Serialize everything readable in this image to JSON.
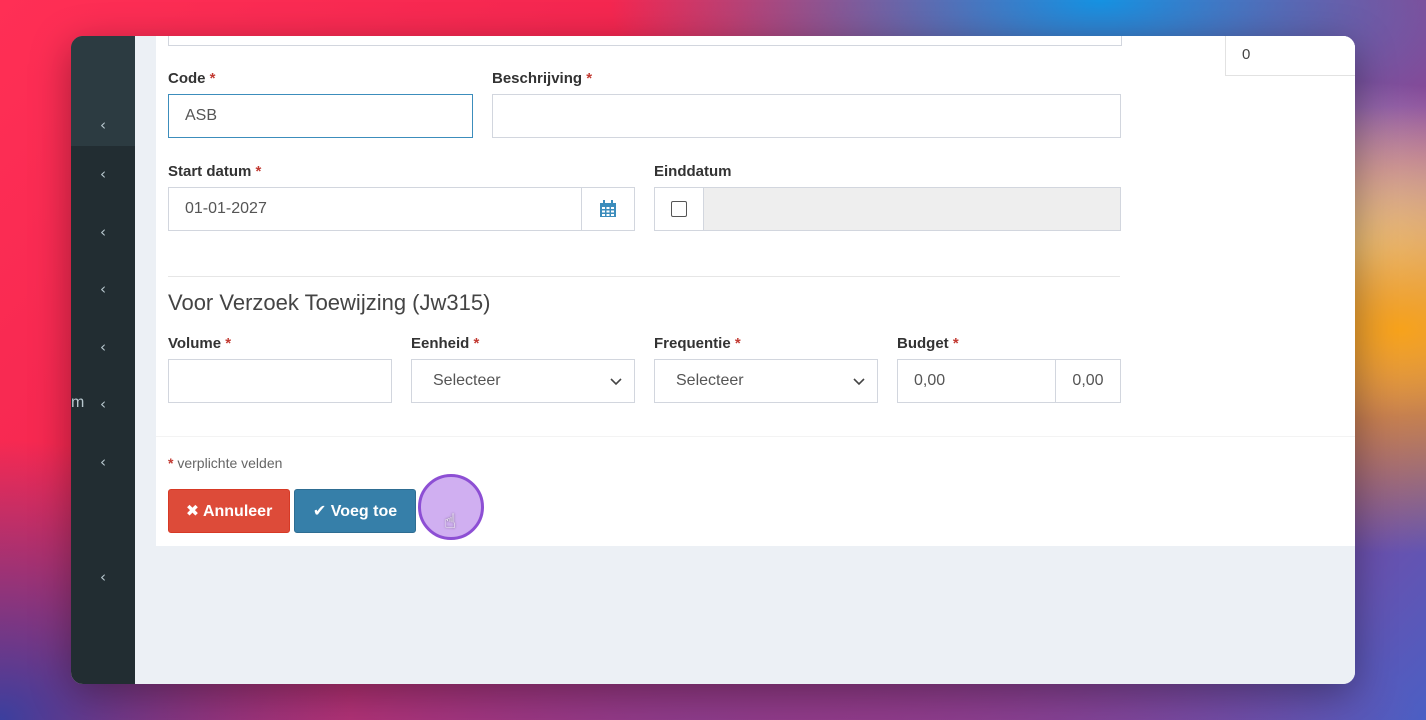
{
  "sidebar": {
    "chevrons": [
      "‹",
      "‹",
      "‹",
      "‹",
      "‹",
      "‹",
      "‹",
      "‹"
    ],
    "partial_label": "m"
  },
  "top": {
    "right_value": "0"
  },
  "form": {
    "code": {
      "label": "Code",
      "value": "ASB",
      "required": "*"
    },
    "beschrijving": {
      "label": "Beschrijving",
      "value": "",
      "required": "*"
    },
    "start_datum": {
      "label": "Start datum",
      "value": "01-01-2027",
      "required": "*",
      "icon": "calendar-icon"
    },
    "einddatum": {
      "label": "Einddatum",
      "value": ""
    }
  },
  "section": {
    "title": "Voor Verzoek Toewijzing (Jw315)",
    "volume": {
      "label": "Volume",
      "value": "",
      "required": "*"
    },
    "eenheid": {
      "label": "Eenheid",
      "selected": "Selecteer",
      "required": "*"
    },
    "frequentie": {
      "label": "Frequentie",
      "selected": "Selecteer",
      "required": "*"
    },
    "budget": {
      "label": "Budget",
      "value": "0,00",
      "addon": "0,00",
      "required": "*"
    }
  },
  "footer": {
    "required_marker": "*",
    "required_note": "verplichte velden",
    "cancel_label": "Annuleer",
    "add_label": "Voeg toe"
  },
  "colors": {
    "danger": "#dd4b39",
    "primary": "#367fa9",
    "sidebar": "#222d32",
    "required": "#c23a32"
  }
}
